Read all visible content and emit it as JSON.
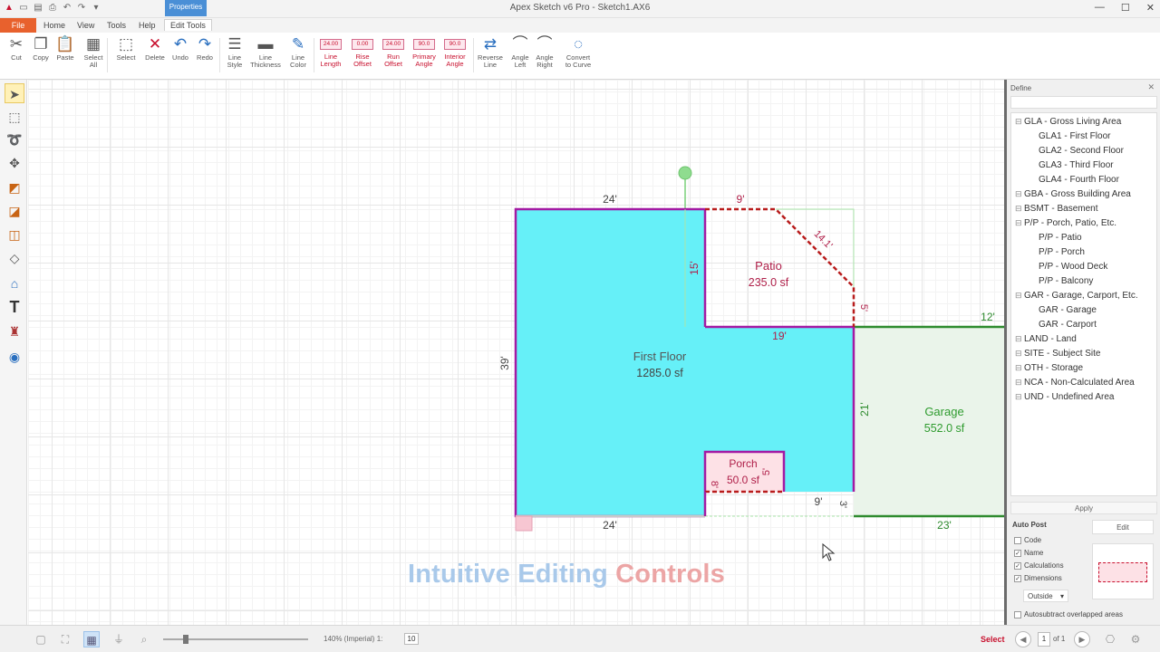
{
  "window": {
    "title": "Apex Sketch v6 Pro - Sketch1.AX6",
    "minimize": "—",
    "maximize": "☐",
    "close": "✕"
  },
  "ribbon": {
    "context_label": "Properties",
    "tabs": {
      "file": "File",
      "home": "Home",
      "view": "View",
      "tools": "Tools",
      "help": "Help",
      "edit_tools": "Edit Tools"
    },
    "buttons": {
      "cut": "Cut",
      "copy": "Copy",
      "paste": "Paste",
      "select_all": "Select All",
      "select": "Select",
      "delete": "Delete",
      "undo": "Undo",
      "redo": "Redo",
      "line_style": "Line Style",
      "line_thickness": "Line Thickness",
      "line_color": "Line Color",
      "line_length": "Line Length",
      "rise_offset": "Rise Offset",
      "run_offset": "Run Offset",
      "primary_angle": "Primary Angle",
      "interior_angle": "Interior Angle",
      "reverse_line": "Reverse Line",
      "angle_left": "Angle Left",
      "angle_right": "Angle Right",
      "convert_to_curve": "Convert to Curve"
    },
    "values": {
      "line_length": "24.00",
      "rise_offset": "0.00",
      "run_offset": "24.00",
      "primary_angle": "90.0",
      "interior_angle": "90.0"
    }
  },
  "sketch": {
    "areas": [
      {
        "name": "First Floor",
        "area": "1285.0 sf"
      },
      {
        "name": "Patio",
        "area": "235.0 sf"
      },
      {
        "name": "Garage",
        "area": "552.0 sf"
      },
      {
        "name": "Porch",
        "area": "50.0 sf"
      }
    ],
    "dims": {
      "ff_top": "24'",
      "ff_bottom": "24'",
      "ff_left": "39'",
      "patio_top": "9'",
      "patio_diag": "14.1'",
      "patio_left": "15'",
      "patio_bottom": "19'",
      "patio_right": "5'",
      "garage_top": "12'",
      "garage_left": "21'",
      "garage_bottom": "23'",
      "porch_left": "8'",
      "porch_right": "5'",
      "porch_bottom": "9'",
      "porch_right_low": "3'"
    },
    "colors": {
      "first_floor_fill": "#66f0f8",
      "outline_purple": "#a31aa3",
      "patio_dashed": "#b81c1c",
      "garage_green": "#2e8b2e",
      "garage_label": "#2e9b2e",
      "label_red": "#b0204a"
    }
  },
  "watermark": {
    "part1": "Intuitive Editing",
    "part2": "Controls"
  },
  "define_panel": {
    "title": "Define",
    "close": "✕",
    "tree": [
      {
        "label": "GLA - Gross Living Area",
        "level": 0
      },
      {
        "label": "GLA1 - First Floor",
        "level": 1
      },
      {
        "label": "GLA2 - Second Floor",
        "level": 1
      },
      {
        "label": "GLA3 - Third Floor",
        "level": 1
      },
      {
        "label": "GLA4 - Fourth Floor",
        "level": 1
      },
      {
        "label": "GBA - Gross Building Area",
        "level": 0
      },
      {
        "label": "BSMT - Basement",
        "level": 0
      },
      {
        "label": "P/P - Porch, Patio, Etc.",
        "level": 0
      },
      {
        "label": "P/P - Patio",
        "level": 1
      },
      {
        "label": "P/P - Porch",
        "level": 1
      },
      {
        "label": "P/P - Wood Deck",
        "level": 1
      },
      {
        "label": "P/P - Balcony",
        "level": 1
      },
      {
        "label": "GAR - Garage, Carport, Etc.",
        "level": 0
      },
      {
        "label": "GAR - Garage",
        "level": 1
      },
      {
        "label": "GAR - Carport",
        "level": 1
      },
      {
        "label": "LAND - Land",
        "level": 0
      },
      {
        "label": "SITE - Subject Site",
        "level": 0
      },
      {
        "label": "OTH - Storage",
        "level": 0
      },
      {
        "label": "NCA - Non-Calculated Area",
        "level": 0
      },
      {
        "label": "UND - Undefined Area",
        "level": 0
      }
    ],
    "apply": "Apply",
    "auto_post": "Auto Post",
    "edit": "Edit",
    "checks": [
      {
        "label": "Code",
        "checked": false
      },
      {
        "label": "Name",
        "checked": true
      },
      {
        "label": "Calculations",
        "checked": true
      },
      {
        "label": "Dimensions",
        "checked": true
      }
    ],
    "placement": "Outside",
    "auto_subtract": "Autosubtract overlapped areas"
  },
  "status": {
    "zoom": "140% (Imperial) 1:",
    "scale": "10",
    "mode": "Select",
    "page": "1",
    "page_of": "of 1"
  }
}
